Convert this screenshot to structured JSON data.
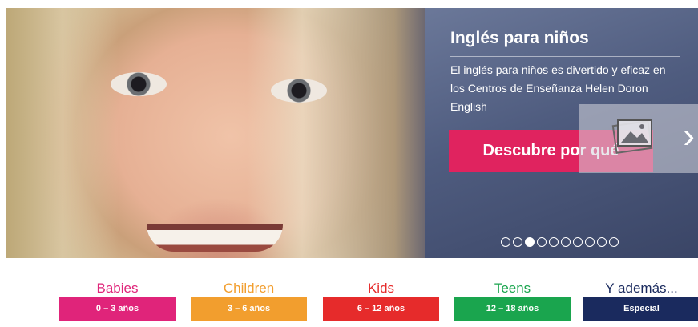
{
  "hero": {
    "title": "Inglés para niños",
    "description": "El inglés para niños es divertido y eficaz en los Centros de Enseñanza Helen Doron English",
    "cta_label": "Descubre por qué",
    "slide_count": 10,
    "active_slide": 3,
    "icons": {
      "image": "image-icon",
      "next": "chevron-right-icon"
    },
    "colors": {
      "panel": "#4f5c7f",
      "cta": "#e0235f"
    }
  },
  "categories": [
    {
      "label": "Babies",
      "button": "0 – 3 años",
      "color": "#e0247a"
    },
    {
      "label": "Children",
      "button": "3 – 6 años",
      "color": "#f29e2e"
    },
    {
      "label": "Kids",
      "button": "6 – 12 años",
      "color": "#e62b2b"
    },
    {
      "label": "Teens",
      "button": "12 – 18 años",
      "color": "#1aa54e"
    },
    {
      "label": "Y además...",
      "button": "Especial",
      "color": "#1a2a5e"
    }
  ]
}
